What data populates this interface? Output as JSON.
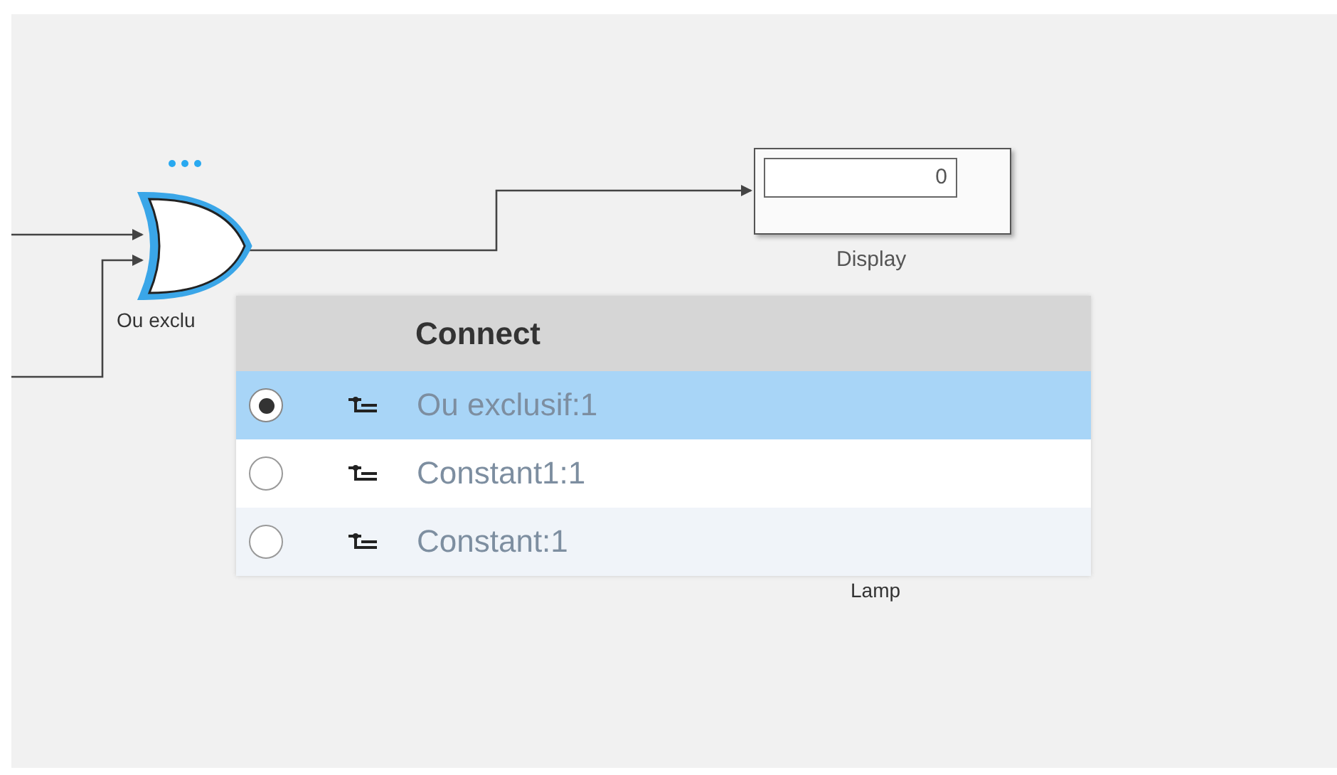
{
  "diagram": {
    "gate": {
      "label": "Ou exclu",
      "selected": true
    },
    "display": {
      "value": "0",
      "label": "Display"
    },
    "lamp": {
      "label": "Lamp"
    }
  },
  "connect_menu": {
    "title": "Connect",
    "rows": [
      {
        "label": "Ou exclusif:1",
        "selected": true
      },
      {
        "label": "Constant1:1",
        "selected": false
      },
      {
        "label": "Constant:1",
        "selected": false
      }
    ]
  }
}
